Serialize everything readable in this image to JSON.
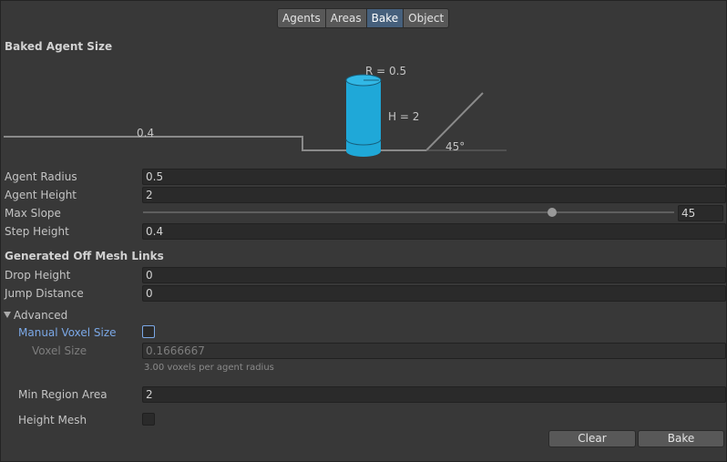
{
  "tabs": [
    "Agents",
    "Areas",
    "Bake",
    "Object"
  ],
  "active_tab": "Bake",
  "baked_agent_size": {
    "title": "Baked Agent Size",
    "step_label": "0.4",
    "radius_label": "R = 0.5",
    "height_label": "H = 2",
    "slope_label": "45°",
    "cylinder_color": "#1fa8d8"
  },
  "fields": {
    "agent_radius": {
      "label": "Agent Radius",
      "value": "0.5"
    },
    "agent_height": {
      "label": "Agent Height",
      "value": "2"
    },
    "max_slope": {
      "label": "Max Slope",
      "value": "45",
      "fraction": 0.77
    },
    "step_height": {
      "label": "Step Height",
      "value": "0.4"
    }
  },
  "off_mesh": {
    "title": "Generated Off Mesh Links",
    "drop_height": {
      "label": "Drop Height",
      "value": "0"
    },
    "jump_distance": {
      "label": "Jump Distance",
      "value": "0"
    }
  },
  "advanced": {
    "title": "Advanced",
    "manual_voxel_size": {
      "label": "Manual Voxel Size",
      "checked": false
    },
    "voxel_size": {
      "label": "Voxel Size",
      "value": "0.1666667"
    },
    "voxel_hint": "3.00 voxels per agent radius",
    "min_region_area": {
      "label": "Min Region Area",
      "value": "2"
    },
    "height_mesh": {
      "label": "Height Mesh",
      "checked": false
    }
  },
  "buttons": {
    "clear": "Clear",
    "bake": "Bake"
  },
  "colors": {
    "accent": "#46607c",
    "highlight_label": "#7ba8e6"
  }
}
